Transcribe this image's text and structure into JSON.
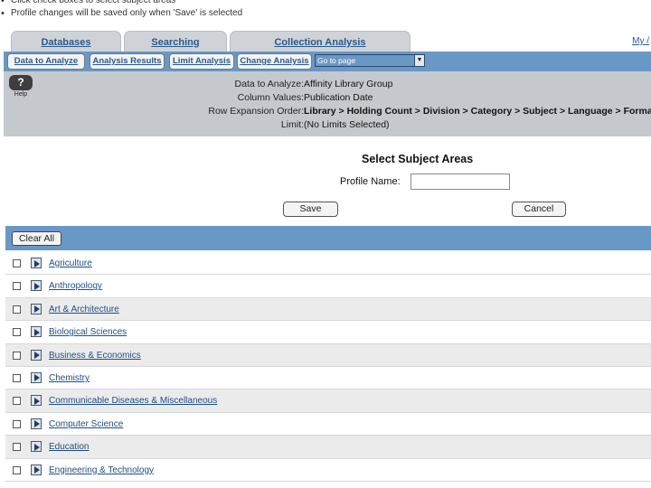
{
  "instructions": [
    "Click check boxes to select subject areas",
    "Profile changes will be saved only when 'Save' is selected"
  ],
  "tabs": [
    "Databases",
    "Searching",
    "Collection Analysis"
  ],
  "my_link": "My /",
  "toolbar": {
    "data_to_analyze": "Data to Analyze",
    "analysis_results": "Analysis Results",
    "limit_analysis": "Limit Analysis",
    "change_analysis": "Change Analysis",
    "goto_page": "Go to page"
  },
  "help": {
    "label": "Help",
    "glyph": "?"
  },
  "info": {
    "data_to_analyze_label": "Data to Analyze:",
    "data_to_analyze_value": "Affinity Library Group",
    "column_values_label": "Column Values:",
    "column_values_value": "Publication Date",
    "row_expansion_label": "Row Expansion Order:",
    "row_expansion_value": "Library > Holding Count > Division > Category > Subject > Language > Format > ...",
    "limit_label": "Limit:",
    "limit_value": "(No Limits Selected)"
  },
  "form": {
    "heading": "Select Subject Areas",
    "profile_name_label": "Profile Name:",
    "profile_name_value": "",
    "save_label": "Save",
    "cancel_label": "Cancel",
    "clear_all_label": "Clear All"
  },
  "subjects": [
    "Agriculture",
    "Anthropology",
    "Art & Architecture",
    "Biological Sciences",
    "Business & Economics",
    "Chemistry",
    "Communicable Diseases & Miscellaneous",
    "Computer Science",
    "Education",
    "Engineering & Technology"
  ],
  "colors": {
    "toolbar_blue": "#6a98c6",
    "info_gray": "#c5c9ce",
    "link_blue": "#1e4f85"
  }
}
